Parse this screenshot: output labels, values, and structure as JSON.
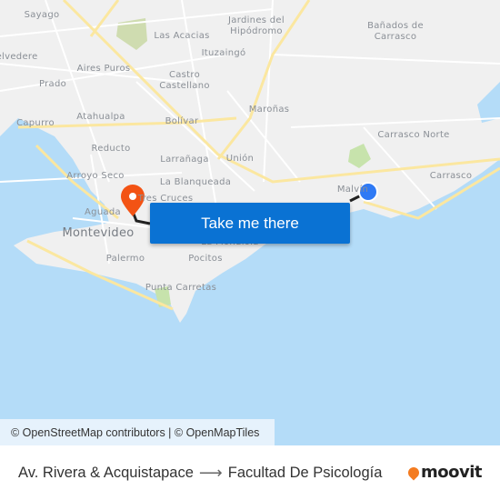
{
  "map": {
    "labels": [
      {
        "text": "Sayago"
      },
      {
        "text": "Las Acacias"
      },
      {
        "text": "Jardines del\nHipódromo"
      },
      {
        "text": "Bañados de\nCarrasco"
      },
      {
        "text": "Belvedere"
      },
      {
        "text": "Aires Puros"
      },
      {
        "text": "Ituzaingó"
      },
      {
        "text": "Castro\nCastellano"
      },
      {
        "text": "Prado"
      },
      {
        "text": "Maroñas"
      },
      {
        "text": "Capurro"
      },
      {
        "text": "Atahualpa"
      },
      {
        "text": "Bolívar"
      },
      {
        "text": "Carrasco Norte"
      },
      {
        "text": "Reducto"
      },
      {
        "text": "Larrañaga"
      },
      {
        "text": "Unión"
      },
      {
        "text": "Carrasco"
      },
      {
        "text": "Arroyo Seco"
      },
      {
        "text": "La Blanqueada"
      },
      {
        "text": "Malvín"
      },
      {
        "text": "Tres Cruces"
      },
      {
        "text": "Aguada"
      },
      {
        "text": "Montevideo"
      },
      {
        "text": "La Mondiola"
      },
      {
        "text": "Palermo"
      },
      {
        "text": "Pocitos"
      },
      {
        "text": "Punta Carretas"
      }
    ],
    "origin_marker_color": "#2f7af5",
    "destination_marker_color": "#f35314",
    "water_color": "#b4dcf8",
    "cta_label": "Take me there",
    "cta_color": "#0a72d3",
    "attribution": "© OpenStreetMap contributors | © OpenMapTiles"
  },
  "footer": {
    "origin": "Av. Rivera & Acquistapace",
    "arrow": "⟶",
    "destination": "Facultad De Psicología",
    "brand": "moovit",
    "brand_color": "#f47b20"
  }
}
